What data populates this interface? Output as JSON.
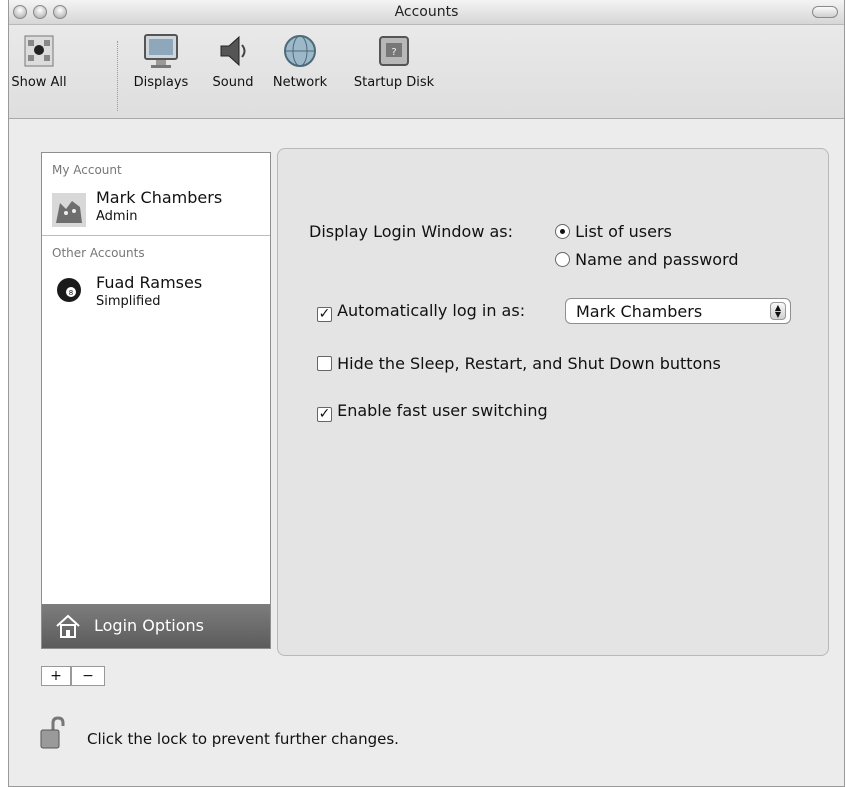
{
  "window": {
    "title": "Accounts"
  },
  "toolbar": {
    "items": [
      {
        "label": "Show All",
        "icon": "show-all-icon"
      },
      {
        "label": "Displays",
        "icon": "display-icon"
      },
      {
        "label": "Sound",
        "icon": "speaker-icon"
      },
      {
        "label": "Network",
        "icon": "globe-icon"
      },
      {
        "label": "Startup Disk",
        "icon": "disk-icon"
      }
    ]
  },
  "sidebar": {
    "my_account_label": "My Account",
    "my_account": {
      "name": "Mark Chambers",
      "role": "Admin",
      "icon": "cat-avatar-icon"
    },
    "other_accounts_label": "Other Accounts",
    "other_accounts": [
      {
        "name": "Fuad Ramses",
        "role": "Simplified",
        "icon": "eight-ball-avatar-icon"
      }
    ],
    "login_options_label": "Login Options",
    "add_label": "+",
    "remove_label": "−"
  },
  "login_options": {
    "display_login_label": "Display Login Window as:",
    "radio_list_label": "List of users",
    "radio_name_label": "Name and password",
    "selected_display": "List of users",
    "auto_login_label": "Automatically log in as:",
    "auto_login_checked": true,
    "auto_login_user": "Mark Chambers",
    "hide_buttons_label": "Hide the Sleep, Restart, and Shut Down buttons",
    "hide_buttons_checked": false,
    "fast_switch_label": "Enable fast user switching",
    "fast_switch_checked": true
  },
  "footer": {
    "lock_text": "Click the lock to prevent further changes."
  },
  "colors": {
    "window_bg": "#ececec",
    "panel_bg": "#e4e4e4",
    "login_options_bg": "#666666"
  }
}
